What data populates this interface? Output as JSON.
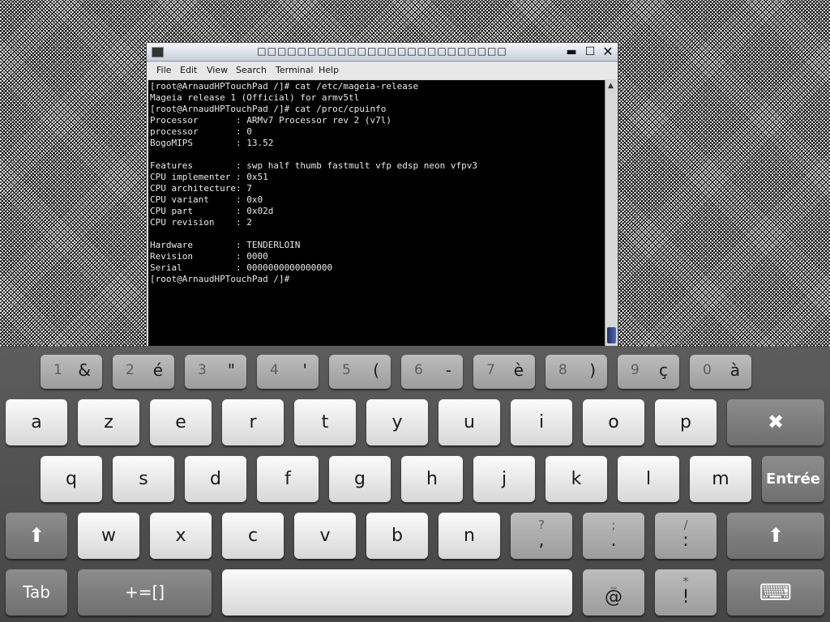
{
  "window": {
    "title": "□□□□□□□□□□□□□□□□□□□□□□□□□",
    "min_glyph": "▬",
    "max_glyph": "☐",
    "close_glyph": "✕",
    "menu": [
      "File",
      "Edit",
      "View",
      "Search",
      "Terminal",
      "Help"
    ]
  },
  "terminal": {
    "lines": [
      "[root@ArnaudHPTouchPad /]# cat /etc/mageia-release",
      "Mageia release 1 (Official) for armv5tl",
      "[root@ArnaudHPTouchPad /]# cat /proc/cpuinfo",
      "Processor       : ARMv7 Processor rev 2 (v7l)",
      "processor       : 0",
      "BogoMIPS        : 13.52",
      "",
      "Features        : swp half thumb fastmult vfp edsp neon vfpv3",
      "CPU implementer : 0x51",
      "CPU architecture: 7",
      "CPU variant     : 0x0",
      "CPU part        : 0x02d",
      "CPU revision    : 2",
      "",
      "Hardware        : TENDERLOIN",
      "Revision        : 0000",
      "Serial          : 0000000000000000",
      "[root@ArnaudHPTouchPad /]#"
    ],
    "scroll_up_glyph": "▲"
  },
  "keyboard": {
    "number_row": [
      {
        "digit": "1",
        "symbol": "&"
      },
      {
        "digit": "2",
        "symbol": "é"
      },
      {
        "digit": "3",
        "symbol": "\""
      },
      {
        "digit": "4",
        "symbol": "'"
      },
      {
        "digit": "5",
        "symbol": "("
      },
      {
        "digit": "6",
        "symbol": "-"
      },
      {
        "digit": "7",
        "symbol": "è"
      },
      {
        "digit": "8",
        "symbol": ")"
      },
      {
        "digit": "9",
        "symbol": "ç"
      },
      {
        "digit": "0",
        "symbol": "à"
      }
    ],
    "row1": [
      "a",
      "z",
      "e",
      "r",
      "t",
      "y",
      "u",
      "i",
      "o",
      "p"
    ],
    "row2": [
      "q",
      "s",
      "d",
      "f",
      "g",
      "h",
      "j",
      "k",
      "l",
      "m"
    ],
    "row3": [
      "w",
      "x",
      "c",
      "v",
      "b",
      "n"
    ],
    "sym_keys": [
      {
        "top": "?",
        "bottom": ","
      },
      {
        "top": ";",
        "bottom": "."
      },
      {
        "top": "/",
        "bottom": ":"
      }
    ],
    "enter_label": "Entrée",
    "tab_label": "Tab",
    "symbols_label": "+=[]",
    "at_key": {
      "top": "_",
      "bottom": "@"
    },
    "excl_key": {
      "top": "*",
      "bottom": "!"
    },
    "backspace_glyph": "✖",
    "shift_glyph": "⬆",
    "hide_keyboard_glyph": "⌨"
  }
}
